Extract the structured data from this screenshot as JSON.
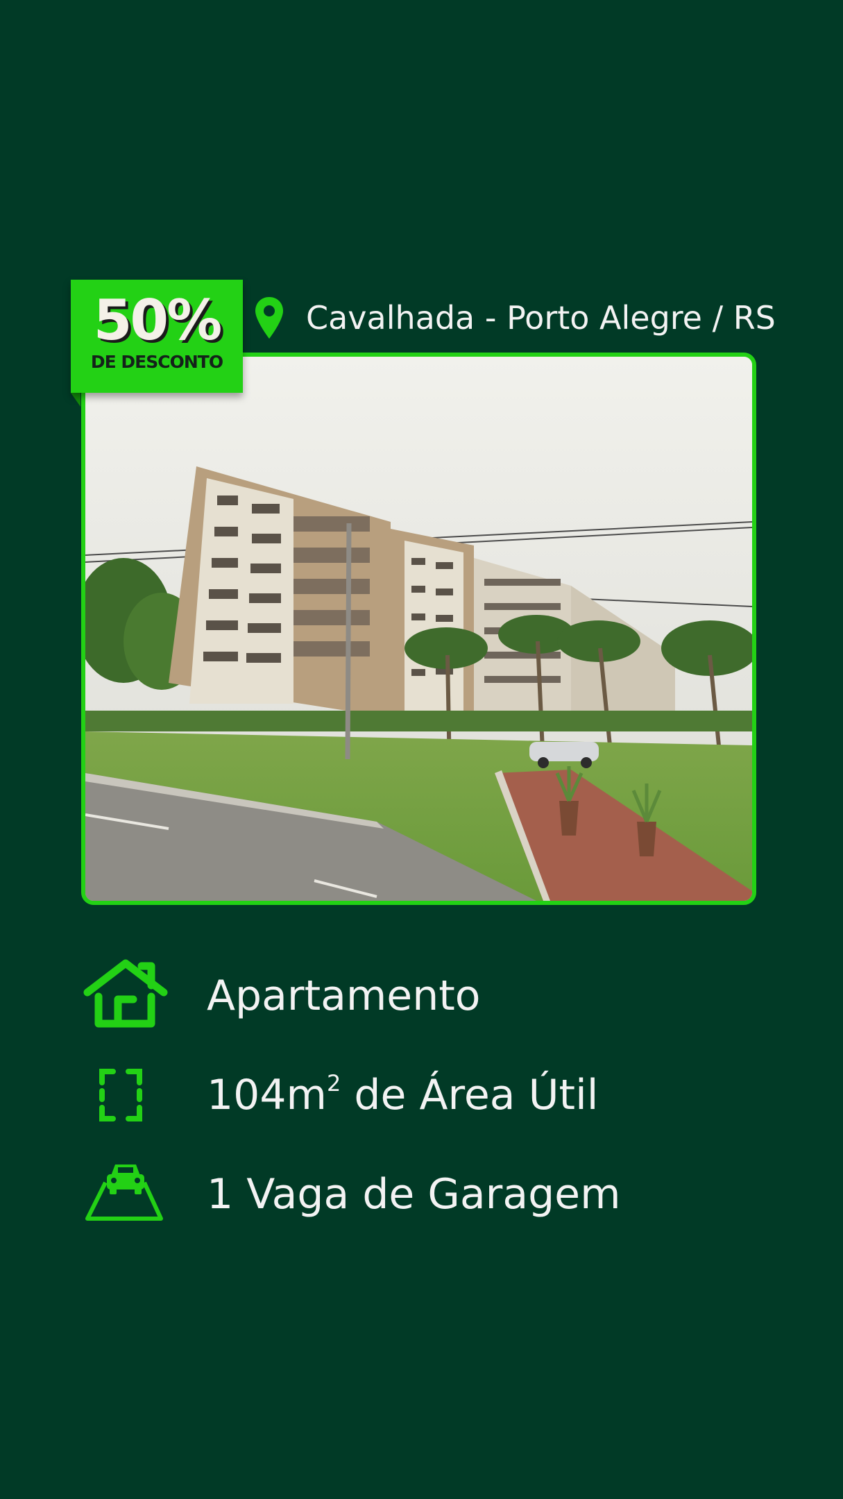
{
  "badge": {
    "percent": "50%",
    "label": "DE DESCONTO"
  },
  "location": {
    "text": "Cavalhada - Porto Alegre / RS",
    "icon": "map-pin-icon"
  },
  "photo": {
    "subject": "apartment-building-photo"
  },
  "features": {
    "type": {
      "icon": "house-icon",
      "text": "Apartamento"
    },
    "area": {
      "icon": "area-frame-icon",
      "value": "104m",
      "superscript": "2",
      "suffix": " de Área Útil"
    },
    "garage": {
      "icon": "car-parking-icon",
      "text": "1 Vaga de Garagem"
    }
  },
  "colors": {
    "background": "#013a26",
    "accent": "#23d115",
    "text": "#f3f3f3"
  }
}
